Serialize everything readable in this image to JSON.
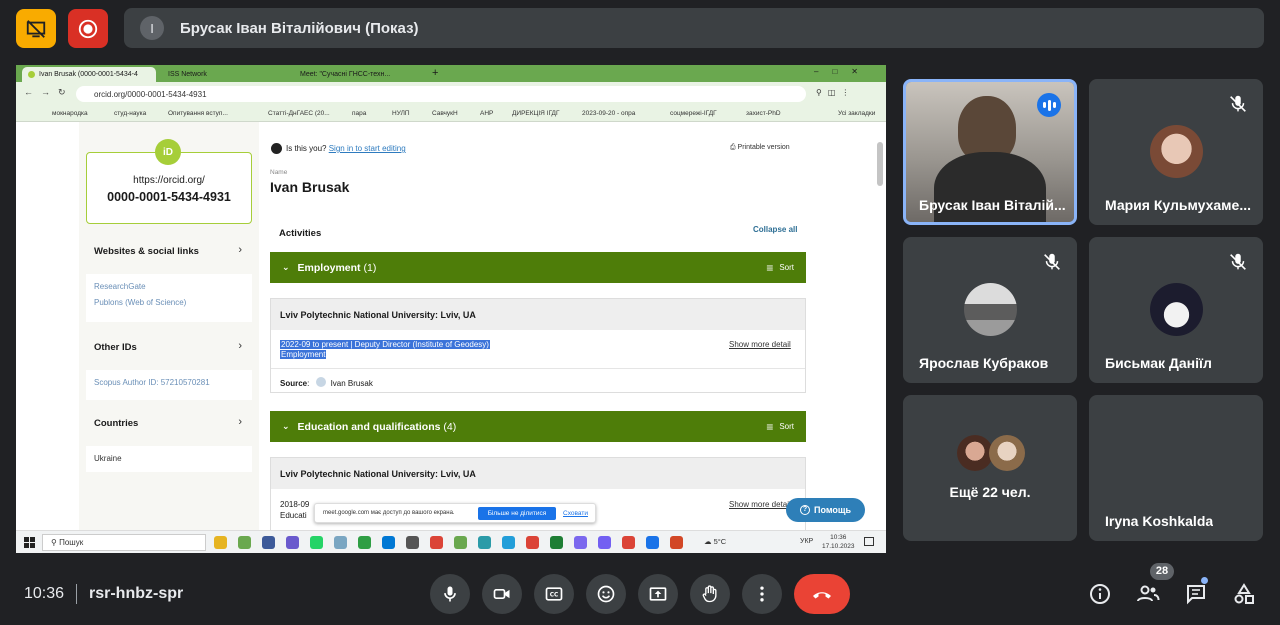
{
  "top": {
    "presenter_initial": "І",
    "presenter_title": "Брусак Іван Віталійович (Показ)"
  },
  "browser": {
    "tabs": [
      "Ivan Brusak (0000-0001-5434-4",
      "ISS Network",
      "Meet: \"Сучасні ГНСС-техн..."
    ],
    "url": "orcid.org/0000-0001-5434-4931",
    "bookmarks": [
      "мокнародка",
      "студ-наука",
      "Опитування вступ...",
      "Статтi-ДнГАЕС (20...",
      "пара",
      "НУЛП",
      "СавчукН",
      "АНР",
      "ДИРЕКЦІЯ ІГДГ",
      "2023-09-20 - опра",
      "соцмережі-ІГДГ",
      "захист-PhD",
      "Усі закладки"
    ]
  },
  "orcid": {
    "logo": "iD",
    "url_line": "https://orcid.org/",
    "id": "0000-0001-5434-4931",
    "is_this_you": "Is this you?",
    "sign_in": "Sign in to start editing",
    "printable": "Printable version",
    "name_label": "Name",
    "name": "Ivan Brusak",
    "activities": "Activities",
    "collapse_all": "Collapse all",
    "sidebar": {
      "websites_title": "Websites & social links",
      "websites": [
        "ResearchGate",
        "Publons (Web of Science)"
      ],
      "other_ids_title": "Other IDs",
      "other_ids": [
        "Scopus Author ID: 57210570281"
      ],
      "countries_title": "Countries",
      "countries": [
        "Ukraine"
      ]
    },
    "employment": {
      "title": "Employment",
      "count": "(1)",
      "sort": "Sort",
      "org": "Lviv Polytechnic National University: Lviv, UA",
      "role": "2022-09 to present | Deputy Director (Institute of Geodesy)",
      "type": "Employment",
      "show_more": "Show more detail",
      "source_label": "Source",
      "source": "Ivan Brusak"
    },
    "education": {
      "title": "Education and qualifications",
      "count": "(4)",
      "sort": "Sort",
      "org": "Lviv Polytechnic National University: Lviv, UA",
      "partial_date": "2018-09",
      "partial_type": "Educati",
      "show_more": "Show more detail"
    },
    "help_button": "Помощь",
    "share_notice": "meet.google.com має доступ до вашого екрана.",
    "stop_share": "Більше не ділитися",
    "hide": "Сховати"
  },
  "taskbar": {
    "search": "Пошук",
    "weather": "5°C",
    "lang": "УКР",
    "time": "10:36",
    "date": "17.10.2023"
  },
  "participants": [
    {
      "name": "Брусак Іван Віталій..."
    },
    {
      "name": "Мария Кульмухаме..."
    },
    {
      "name": "Ярослав Кубраков"
    },
    {
      "name": "Бисьмак Даніїл"
    },
    {
      "name": "Ещё 22 чел."
    },
    {
      "name": "Iryna Koshkalda"
    }
  ],
  "bottom": {
    "time": "10:36",
    "meeting_code": "rsr-hnbz-spr",
    "people_count": "28"
  },
  "colors": {
    "meet_bg": "#202124",
    "tile_bg": "#3c4043",
    "end_call": "#ea4335",
    "orcid_green": "#4e7d09",
    "orcid_lime": "#a6ce39",
    "active_speaker": "#8ab4f8"
  }
}
